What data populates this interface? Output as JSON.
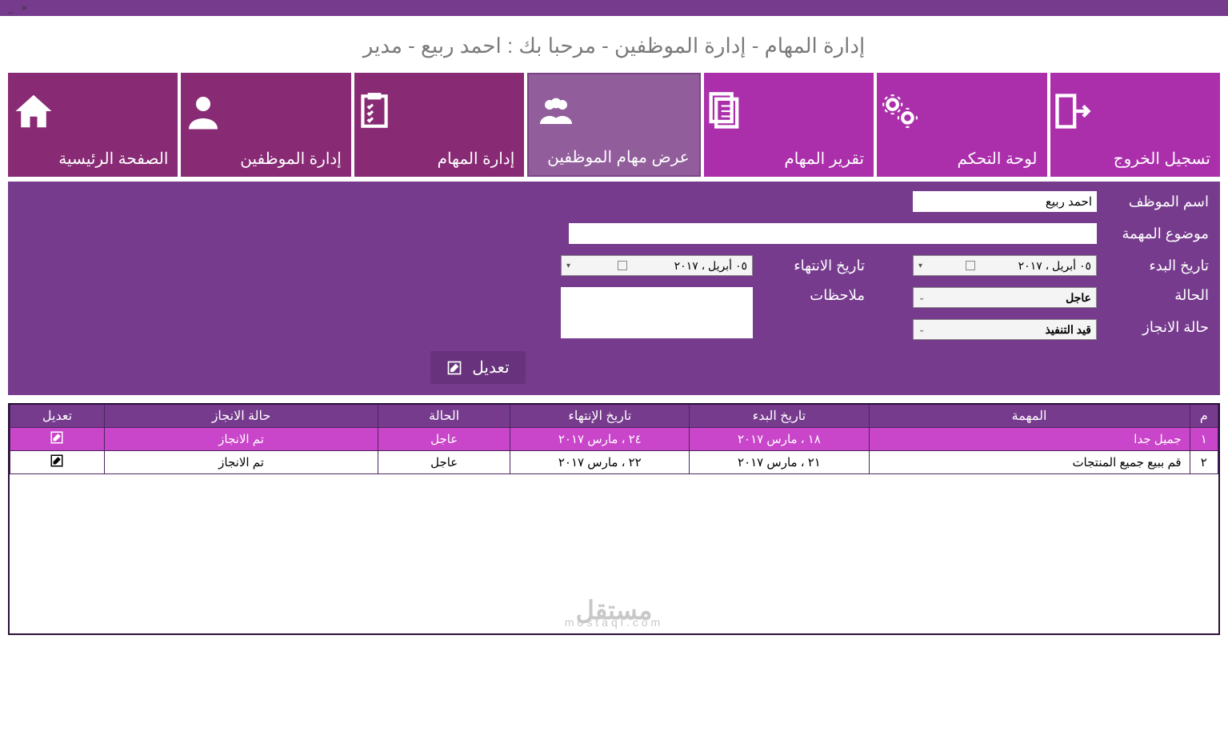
{
  "window": {
    "close": "×",
    "min": "_"
  },
  "header": {
    "title": "إدارة المهام - إدارة الموظفين - مرحبا بك : احمد ربيع - مدير"
  },
  "tiles": {
    "home": "الصفحة الرئيسية",
    "employees": "إدارة الموظفين",
    "tasks": "إدارة المهام",
    "view_tasks": "عرض مهام الموظفين",
    "report": "تقرير المهام",
    "dashboard": "لوحة التحكم",
    "logout": "تسجيل الخروج"
  },
  "form": {
    "employee_label": "اسم الموظف",
    "employee_value": "احمد ربيع",
    "subject_label": "موضوع المهمة",
    "subject_value": "",
    "start_date_label": "تاريخ البدء",
    "start_date_value": "٠٥  أبريل ، ٢٠١٧",
    "end_date_label": "تاريخ الانتهاء",
    "end_date_value": "٠٥  أبريل ، ٢٠١٧",
    "status_label": "الحالة",
    "status_value": "عاجل",
    "notes_label": "ملاحظات",
    "notes_value": "",
    "progress_label": "حالة الانجاز",
    "progress_value": "قيد التنفيذ",
    "edit_btn": "تعديل"
  },
  "table": {
    "headers": {
      "m": "م",
      "task": "المهمة",
      "start": "تاريخ البدء",
      "end": "تاريخ الإنتهاء",
      "status": "الحالة",
      "progress": "حالة الانجاز",
      "edit": "تعديل"
    },
    "rows": [
      {
        "m": "١",
        "task": "جميل جدا",
        "start": "١٨ ، مارس ٢٠١٧",
        "end": "٢٤ ، مارس ٢٠١٧",
        "status": "عاجل",
        "progress": "تم الانجاز"
      },
      {
        "m": "٢",
        "task": "قم ببيع جميع المنتجات",
        "start": "٢١ ، مارس ٢٠١٧",
        "end": "٢٢ ، مارس ٢٠١٧",
        "status": "عاجل",
        "progress": "تم الانجاز"
      }
    ]
  },
  "watermark": {
    "main": "مستقل",
    "sub": "mostaql.com"
  }
}
